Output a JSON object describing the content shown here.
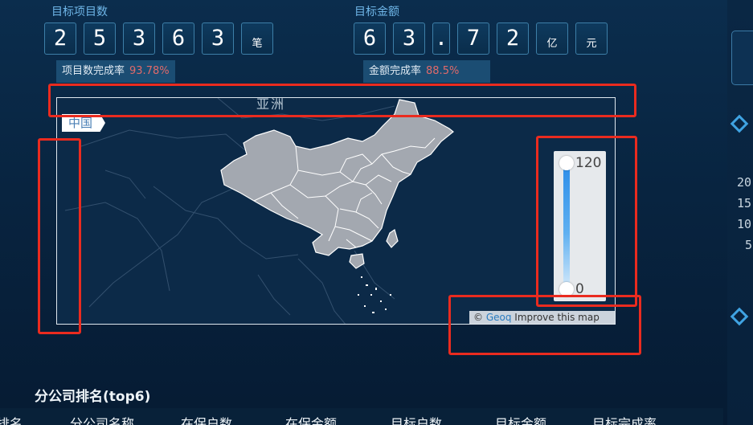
{
  "counters": {
    "project": {
      "label": "目标项目数",
      "digits": [
        "2",
        "5",
        "3",
        "6",
        "3"
      ],
      "unit": "笔",
      "rate_label": "项目数完成率",
      "rate_value": "93.78%"
    },
    "amount": {
      "label": "目标金额",
      "digits": [
        "6",
        "3",
        ".",
        "7",
        "2"
      ],
      "units": [
        "亿",
        "元"
      ],
      "rate_label": "金额完成率",
      "rate_value": "88.5%"
    }
  },
  "map": {
    "tag": "中国",
    "region_label": "亚洲",
    "attribution": {
      "prefix": "©",
      "link": "Geoq",
      "action": "Improve this map"
    },
    "visual_map": {
      "max": "120",
      "min": "0",
      "color_high": "#2b8ce8",
      "color_low": "#d9ecfb"
    },
    "fill_color": "#a3a8b0"
  },
  "ranking": {
    "title": "分公司排名(top6)",
    "columns": [
      "排名",
      "分公司名称",
      "在保户数",
      "在保金额",
      "目标户数",
      "目标金额",
      "目标完成率"
    ]
  },
  "right_panel": {
    "axis_ticks": [
      "20",
      "15",
      "10",
      "5"
    ]
  },
  "colors": {
    "annotation": "#ea2b1f",
    "accent": "#6fb6e8",
    "rate": "#e06a6a"
  }
}
